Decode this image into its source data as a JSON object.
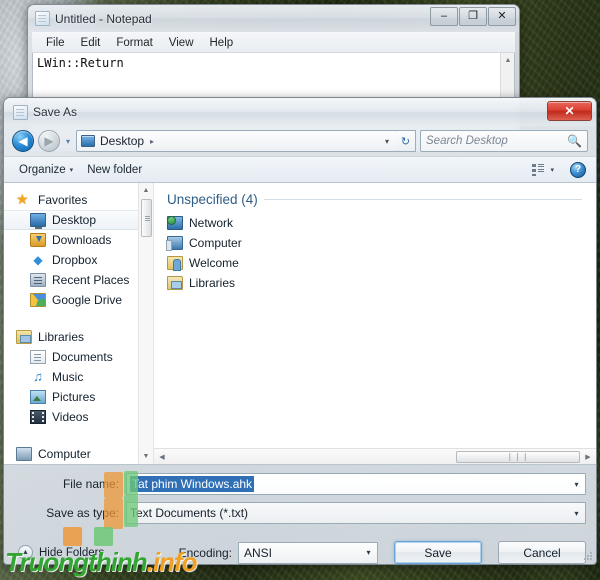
{
  "notepad": {
    "title": "Untitled - Notepad",
    "icon": "notepad-icon",
    "window_buttons": {
      "minimize": "–",
      "maximize": "❐",
      "close": "✕"
    },
    "menu": [
      "File",
      "Edit",
      "Format",
      "View",
      "Help"
    ],
    "text": "LWin::Return"
  },
  "saveas": {
    "title": "Save As",
    "close_label": "✕",
    "nav": {
      "back": "◀",
      "forward": "▶",
      "history": "▾",
      "refresh": "↻"
    },
    "breadcrumb": {
      "current": "Desktop",
      "separator": "▸",
      "dropdown": "▾"
    },
    "search": {
      "placeholder": "Search Desktop",
      "icon": "search-icon"
    },
    "commandbar": {
      "organize": "Organize",
      "organize_caret": "▾",
      "new_folder": "New folder",
      "view_caret": "▾",
      "help": "?"
    },
    "navpane": {
      "groups": [
        {
          "label": "Favorites",
          "icon": "star-icon",
          "items": [
            {
              "label": "Desktop",
              "icon": "desktop-icon",
              "selected": true
            },
            {
              "label": "Downloads",
              "icon": "downloads-icon",
              "selected": false
            },
            {
              "label": "Dropbox",
              "icon": "dropbox-icon",
              "selected": false
            },
            {
              "label": "Recent Places",
              "icon": "recent-places-icon",
              "selected": false
            },
            {
              "label": "Google Drive",
              "icon": "google-drive-icon",
              "selected": false
            }
          ]
        },
        {
          "label": "Libraries",
          "icon": "library-icon",
          "items": [
            {
              "label": "Documents",
              "icon": "document-icon",
              "selected": false
            },
            {
              "label": "Music",
              "icon": "music-icon",
              "selected": false
            },
            {
              "label": "Pictures",
              "icon": "pictures-icon",
              "selected": false
            },
            {
              "label": "Videos",
              "icon": "video-icon",
              "selected": false
            }
          ]
        },
        {
          "label": "Computer",
          "icon": "computer-icon",
          "items": []
        }
      ],
      "scroll_up": "▲",
      "scroll_down": "▼"
    },
    "filelist": {
      "group_header": "Unspecified (4)",
      "items": [
        {
          "label": "Network",
          "icon": "network-icon"
        },
        {
          "label": "Computer",
          "icon": "computer-icon"
        },
        {
          "label": "Welcome",
          "icon": "welcome-folder-icon"
        },
        {
          "label": "Libraries",
          "icon": "libraries-folder-icon"
        }
      ],
      "hscroll": {
        "left": "◀",
        "right": "▶",
        "thumb": "❘❘❘"
      }
    },
    "form": {
      "filename_label": "File name:",
      "filename_value": "Tat phim Windows.ahk",
      "filetype_label": "Save as type:",
      "filetype_value": "Text Documents (*.txt)",
      "dropdown_arrow": "▾"
    },
    "footer": {
      "hide_folders": "Hide Folders",
      "hide_folders_arrow": "▲",
      "encoding_label": "Encoding:",
      "encoding_value": "ANSI",
      "save": "Save",
      "cancel": "Cancel"
    }
  },
  "watermark": {
    "name": "Truongthinh",
    "tld": ".info"
  },
  "colors": {
    "selection_blue": "#2f6fb5",
    "close_red": "#d94031",
    "accent_blue": "#2d6ca8",
    "group_header_blue": "#2f5d87",
    "mark_orange": "#f0963a",
    "mark_green": "#6ec878",
    "watermark_green": "#33a533",
    "watermark_orange": "#f0a023"
  }
}
